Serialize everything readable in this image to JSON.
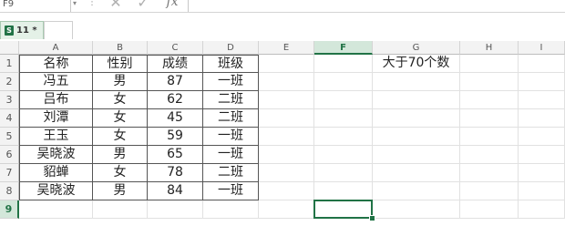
{
  "formula_bar": {
    "name_box": "F9",
    "fx_label": "fx",
    "cancel_glyph": "✕",
    "enter_glyph": "✓",
    "dots_glyph": "⋮",
    "dropdown_glyph": "▾",
    "formula": ""
  },
  "tab": {
    "label": "11 *",
    "icon": "excel-file-icon",
    "icon_letter": "S"
  },
  "grid": {
    "columns": [
      "A",
      "B",
      "C",
      "D",
      "E",
      "F",
      "G",
      "H",
      "I"
    ],
    "rows": [
      "1",
      "2",
      "3",
      "4",
      "5",
      "6",
      "7",
      "8",
      "9"
    ],
    "active_cell": "F9",
    "table": [
      [
        "名称",
        "性别",
        "成绩",
        "班级"
      ],
      [
        "冯五",
        "男",
        "87",
        "一班"
      ],
      [
        "吕布",
        "女",
        "62",
        "二班"
      ],
      [
        "刘潭",
        "女",
        "45",
        "二班"
      ],
      [
        "王玉",
        "女",
        "59",
        "一班"
      ],
      [
        "吴晓波",
        "男",
        "65",
        "一班"
      ],
      [
        "貂蝉",
        "女",
        "78",
        "二班"
      ],
      [
        "吴晓波",
        "男",
        "84",
        "一班"
      ]
    ],
    "g1_label": "大于70个数"
  },
  "colors": {
    "accent": "#217346",
    "header_bg": "#f3f3f3",
    "selected_header_bg": "#d3e7da"
  }
}
